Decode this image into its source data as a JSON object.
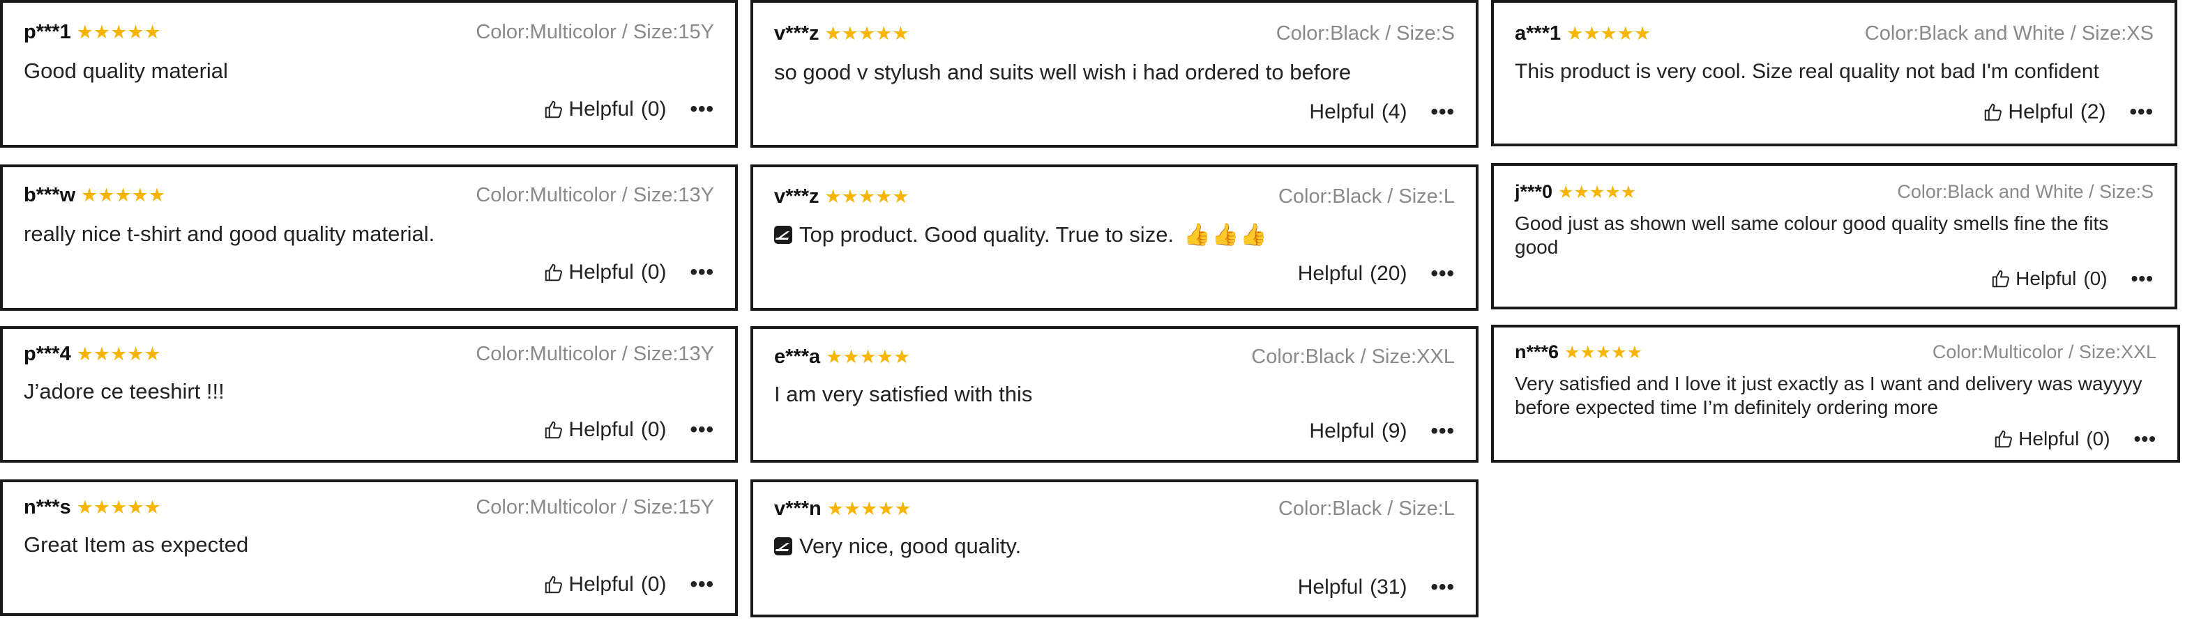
{
  "helpful_label": "Helpful",
  "star_color": "#f7b500",
  "reviews": [
    {
      "user": "p***1",
      "rating": 5,
      "attr": "Color:Multicolor / Size:15Y",
      "text": "Good quality material",
      "count": "(0)"
    },
    {
      "user": "b***w",
      "rating": 5,
      "attr": "Color:Multicolor / Size:13Y",
      "text": "really nice t-shirt and good quality material.",
      "count": "(0)"
    },
    {
      "user": "p***4",
      "rating": 5,
      "attr": "Color:Multicolor / Size:13Y",
      "text": "J’adore ce teeshirt !!!",
      "count": "(0)"
    },
    {
      "user": "n***s",
      "rating": 5,
      "attr": "Color:Multicolor / Size:15Y",
      "text": "Great Item as expected",
      "count": "(0)"
    },
    {
      "user": "v***z",
      "rating": 5,
      "attr": "Color:Black / Size:S",
      "text": "so good v stylush and suits well wish i had ordered to before",
      "count": "(4)"
    },
    {
      "user": "v***z",
      "rating": 5,
      "attr": "Color:Black / Size:L",
      "text": "Top product. Good quality. True to size.",
      "emojis": "👍👍👍",
      "count": "(20)"
    },
    {
      "user": "e***a",
      "rating": 5,
      "attr": "Color:Black / Size:XXL",
      "text": "I am very satisfied with this",
      "count": "(9)"
    },
    {
      "user": "v***n",
      "rating": 5,
      "attr": "Color:Black / Size:L",
      "text": "Very nice, good quality.",
      "count": "(31)"
    },
    {
      "user": "a***1",
      "rating": 5,
      "attr": "Color:Black and White / Size:XS",
      "text": "This product is very cool. Size real quality not bad  I'm confident",
      "count": "(2)"
    },
    {
      "user": "j***0",
      "rating": 5,
      "attr": "Color:Black and White / Size:S",
      "text": "Good just as shown well same colour good quality smells fine the fits good",
      "count": "(0)"
    },
    {
      "user": "n***6",
      "rating": 5,
      "attr": "Color:Multicolor / Size:XXL",
      "text": "Very satisfied and I love it just exactly as I want and delivery was wayyyy before expected time I’m definitely ordering more",
      "count": "(0)"
    }
  ]
}
